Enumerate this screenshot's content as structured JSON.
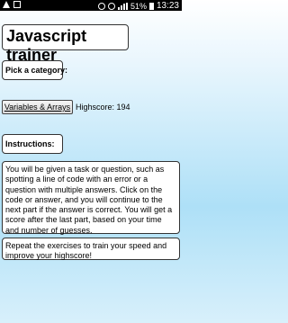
{
  "statusbar": {
    "battery": "51%",
    "time": "13:23",
    "icons": [
      "alert-icon",
      "notification-icon",
      "alarm-icon",
      "wifi-icon",
      "signal-icon",
      "battery-icon"
    ]
  },
  "app": {
    "title": "Javascript trainer",
    "category_label": "Pick a category:",
    "category_button": "Variables & Arrays",
    "highscore": "Highscore: 194",
    "instructions_label": "Instructions:",
    "instructions_text": "You will be given a task or question, such as spotting a line of code with an error or a question with multiple answers. Click on the code or answer, and you will continue to the next part if the answer is correct. You will get a score after the last part, based on your time and number of guesses.",
    "repeat_text": "Repeat the exercises to train your speed and improve your highscore!"
  }
}
